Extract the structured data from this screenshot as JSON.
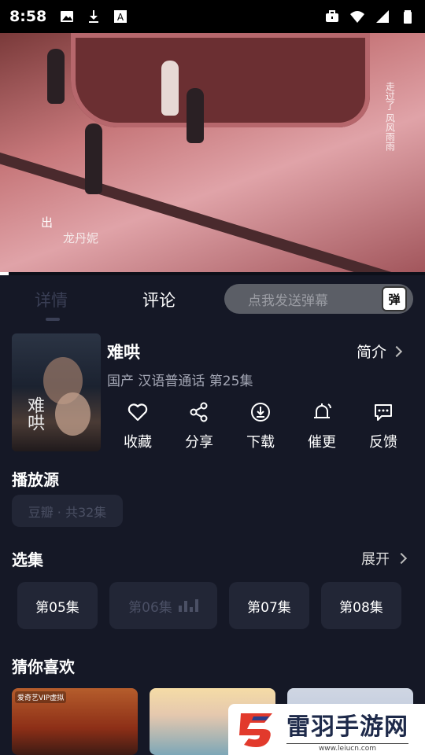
{
  "status_bar": {
    "time": "8:58",
    "left_icons": [
      "image-icon",
      "download-icon",
      "font-icon"
    ],
    "right_icons": [
      "briefcase-icon",
      "wifi-icon",
      "signal-icon",
      "battery-icon"
    ]
  },
  "video": {
    "caption_small": "出",
    "caption_name": "龙丹妮",
    "poem": "走过了 风风雨雨",
    "progress": 0.02
  },
  "tabs": {
    "details": "详情",
    "comments": "评论",
    "danmaku_placeholder": "点我发送弹幕",
    "danmaku_button": "弹"
  },
  "show": {
    "title": "难哄",
    "poster_title": "难哄",
    "meta": "国产 汉语普通话 第25集",
    "intro_label": "简介"
  },
  "actions": [
    {
      "label": "收藏",
      "icon": "heart-icon"
    },
    {
      "label": "分享",
      "icon": "share-icon"
    },
    {
      "label": "下载",
      "icon": "download-circle-icon"
    },
    {
      "label": "催更",
      "icon": "bell-icon"
    },
    {
      "label": "反馈",
      "icon": "feedback-icon"
    }
  ],
  "source": {
    "heading": "播放源",
    "chip": "豆瓣 · 共32集"
  },
  "episodes": {
    "heading": "选集",
    "expand_label": "展开",
    "items": [
      "第05集",
      "第06集",
      "第07集",
      "第08集"
    ],
    "current": "第06集"
  },
  "recommend": {
    "heading": "猜你喜欢",
    "tag1": "爱奇艺VIP虚拟"
  },
  "watermark": {
    "title": "雷羽手游网",
    "url": "www.leiucn.com"
  },
  "colors": {
    "background": "#151826",
    "chip": "#222636",
    "muted": "#4b5065"
  }
}
